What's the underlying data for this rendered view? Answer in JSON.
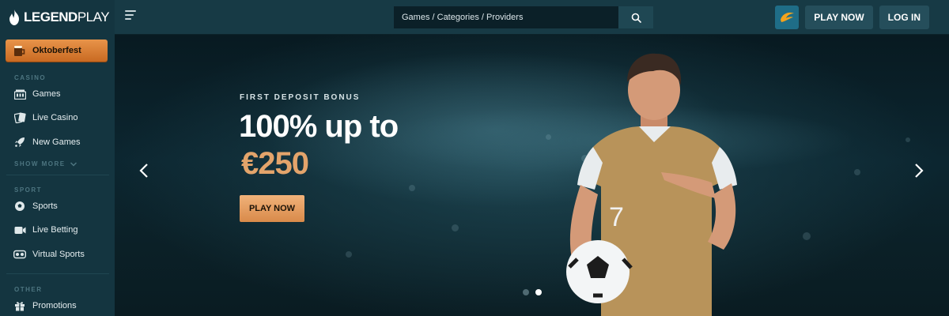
{
  "brand": {
    "logo_primary": "LEGEND",
    "logo_secondary": "PLAY"
  },
  "header": {
    "search_placeholder": "Games / Categories / Providers",
    "play_now": "PLAY NOW",
    "log_in": "LOG IN"
  },
  "sidebar": {
    "featured": "Oktoberfest",
    "sections": [
      {
        "title": "CASINO",
        "items": [
          "Games",
          "Live Casino",
          "New Games"
        ],
        "show_more": "SHOW MORE"
      },
      {
        "title": "SPORT",
        "items": [
          "Sports",
          "Live Betting",
          "Virtual Sports"
        ]
      },
      {
        "title": "OTHER",
        "items": [
          "Promotions"
        ]
      }
    ]
  },
  "hero": {
    "eyebrow": "FIRST DEPOSIT BONUS",
    "headline": "100% up to",
    "amount": "€250",
    "cta": "PLAY NOW",
    "jersey_number": "7",
    "slide_count": 2,
    "active_slide": 2
  },
  "icons": {
    "logo": "flame-icon",
    "menu": "menu-toggle-icon",
    "search": "search-icon",
    "promo": "promo-badge-icon",
    "featured": "beer-mug-icon",
    "games": "slot-machine-icon",
    "live_casino": "playing-cards-icon",
    "new_games": "rocket-icon",
    "show_more": "chevron-down-icon",
    "sports": "soccer-ball-icon",
    "live_betting": "video-camera-icon",
    "virtual_sports": "vr-headset-icon",
    "promotions": "gift-icon",
    "prev": "chevron-left-icon",
    "next": "chevron-right-icon"
  },
  "colors": {
    "header_bg": "#173a45",
    "sidebar_bg": "#143540",
    "accent_orange": "#e3a46b",
    "button_bg": "#254e5b",
    "promo_blue": "#1f6d87"
  }
}
